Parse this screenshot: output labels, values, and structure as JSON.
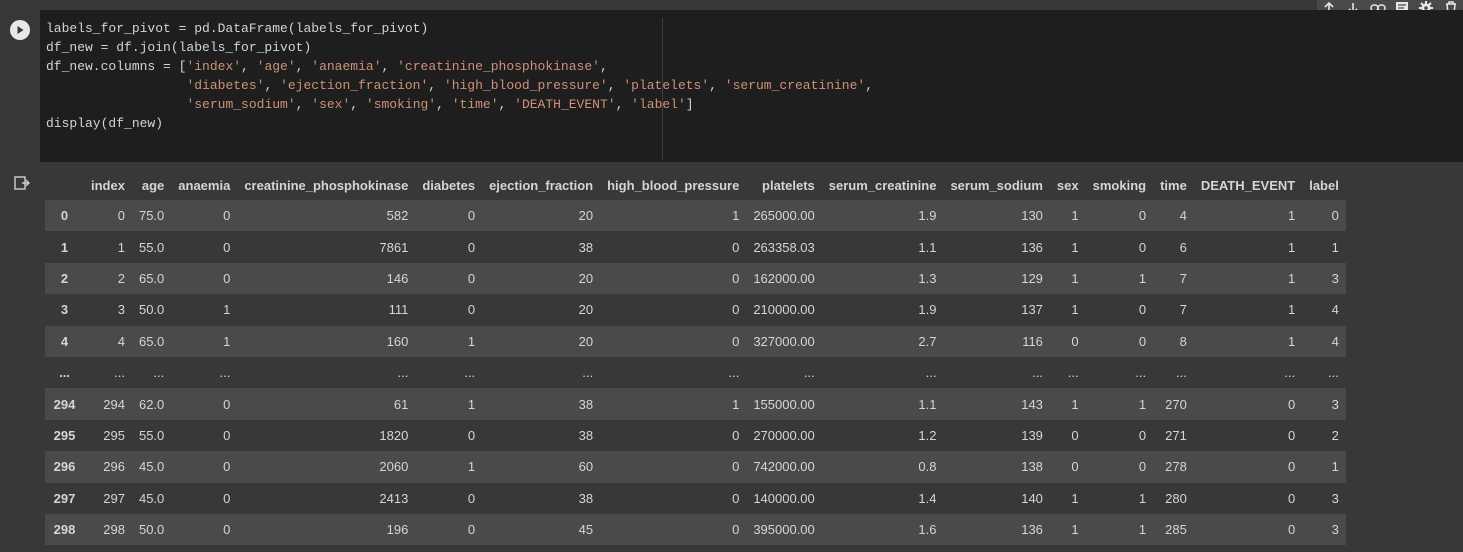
{
  "cell_toolbar": {
    "icons": [
      "arrow-up-icon",
      "arrow-down-icon",
      "link-icon",
      "comment-icon",
      "gear-icon",
      "trash-icon"
    ]
  },
  "code_cell": {
    "lines": [
      [
        {
          "t": "labels_for_pivot = pd.DataFrame(labels_for_pivot)",
          "c": ""
        }
      ],
      [
        {
          "t": "df_new = df.join(labels_for_pivot)",
          "c": ""
        }
      ],
      [
        {
          "t": "df_new.columns = [",
          "c": ""
        },
        {
          "t": "'index'",
          "c": "s"
        },
        {
          "t": ", ",
          "c": ""
        },
        {
          "t": "'age'",
          "c": "s"
        },
        {
          "t": ", ",
          "c": ""
        },
        {
          "t": "'anaemia'",
          "c": "s"
        },
        {
          "t": ", ",
          "c": ""
        },
        {
          "t": "'creatinine_phosphokinase'",
          "c": "s"
        },
        {
          "t": ",",
          "c": ""
        }
      ],
      [
        {
          "t": "                  ",
          "c": ""
        },
        {
          "t": "'diabetes'",
          "c": "s"
        },
        {
          "t": ", ",
          "c": ""
        },
        {
          "t": "'ejection_fraction'",
          "c": "s"
        },
        {
          "t": ", ",
          "c": ""
        },
        {
          "t": "'high_blood_pressure'",
          "c": "s"
        },
        {
          "t": ", ",
          "c": ""
        },
        {
          "t": "'platelets'",
          "c": "s"
        },
        {
          "t": ", ",
          "c": ""
        },
        {
          "t": "'serum_creatinine'",
          "c": "s"
        },
        {
          "t": ",",
          "c": ""
        }
      ],
      [
        {
          "t": "                  ",
          "c": ""
        },
        {
          "t": "'serum_sodium'",
          "c": "s"
        },
        {
          "t": ", ",
          "c": ""
        },
        {
          "t": "'sex'",
          "c": "s"
        },
        {
          "t": ", ",
          "c": ""
        },
        {
          "t": "'smoking'",
          "c": "s"
        },
        {
          "t": ", ",
          "c": ""
        },
        {
          "t": "'time'",
          "c": "s"
        },
        {
          "t": ", ",
          "c": ""
        },
        {
          "t": "'DEATH_EVENT'",
          "c": "s"
        },
        {
          "t": ", ",
          "c": ""
        },
        {
          "t": "'label'",
          "c": "s"
        },
        {
          "t": "]",
          "c": ""
        }
      ],
      [
        {
          "t": "display(df_new)",
          "c": ""
        }
      ]
    ]
  },
  "output": {
    "columns": [
      "",
      "index",
      "age",
      "anaemia",
      "creatinine_phosphokinase",
      "diabetes",
      "ejection_fraction",
      "high_blood_pressure",
      "platelets",
      "serum_creatinine",
      "serum_sodium",
      "sex",
      "smoking",
      "time",
      "DEATH_EVENT",
      "label"
    ],
    "rows": [
      [
        "0",
        "0",
        "75.0",
        "0",
        "582",
        "0",
        "20",
        "1",
        "265000.00",
        "1.9",
        "130",
        "1",
        "0",
        "4",
        "1",
        "0"
      ],
      [
        "1",
        "1",
        "55.0",
        "0",
        "7861",
        "0",
        "38",
        "0",
        "263358.03",
        "1.1",
        "136",
        "1",
        "0",
        "6",
        "1",
        "1"
      ],
      [
        "2",
        "2",
        "65.0",
        "0",
        "146",
        "0",
        "20",
        "0",
        "162000.00",
        "1.3",
        "129",
        "1",
        "1",
        "7",
        "1",
        "3"
      ],
      [
        "3",
        "3",
        "50.0",
        "1",
        "111",
        "0",
        "20",
        "0",
        "210000.00",
        "1.9",
        "137",
        "1",
        "0",
        "7",
        "1",
        "4"
      ],
      [
        "4",
        "4",
        "65.0",
        "1",
        "160",
        "1",
        "20",
        "0",
        "327000.00",
        "2.7",
        "116",
        "0",
        "0",
        "8",
        "1",
        "4"
      ],
      [
        "...",
        "...",
        "...",
        "...",
        "...",
        "...",
        "...",
        "...",
        "...",
        "...",
        "...",
        "...",
        "...",
        "...",
        "...",
        "..."
      ],
      [
        "294",
        "294",
        "62.0",
        "0",
        "61",
        "1",
        "38",
        "1",
        "155000.00",
        "1.1",
        "143",
        "1",
        "1",
        "270",
        "0",
        "3"
      ],
      [
        "295",
        "295",
        "55.0",
        "0",
        "1820",
        "0",
        "38",
        "0",
        "270000.00",
        "1.2",
        "139",
        "0",
        "0",
        "271",
        "0",
        "2"
      ],
      [
        "296",
        "296",
        "45.0",
        "0",
        "2060",
        "1",
        "60",
        "0",
        "742000.00",
        "0.8",
        "138",
        "0",
        "0",
        "278",
        "0",
        "1"
      ],
      [
        "297",
        "297",
        "45.0",
        "0",
        "2413",
        "0",
        "38",
        "0",
        "140000.00",
        "1.4",
        "140",
        "1",
        "1",
        "280",
        "0",
        "3"
      ],
      [
        "298",
        "298",
        "50.0",
        "0",
        "196",
        "0",
        "45",
        "0",
        "395000.00",
        "1.6",
        "136",
        "1",
        "1",
        "285",
        "0",
        "3"
      ]
    ]
  },
  "colors": {
    "background": "#383838",
    "editor_background": "#1e1e1e",
    "string_literal": "#ce9178",
    "row_stripe": "#4a4a4a"
  }
}
